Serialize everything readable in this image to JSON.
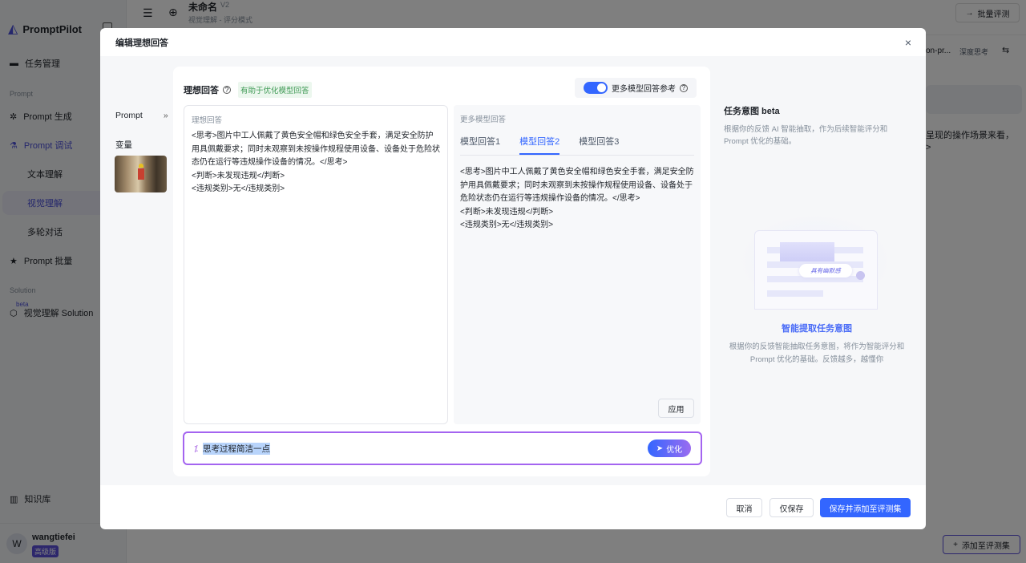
{
  "app": {
    "name": "PromptPilot",
    "doc_title": "未命名",
    "version": "V2",
    "subtitle": "视觉理解 - 评分模式",
    "batch_eval": "批量评测",
    "model_name": "on-pr...",
    "deep_think": "深度思考",
    "bg_text": "呈现的操作场景来看，",
    "bg_text2": ">",
    "add_to_set": "添加至评测集"
  },
  "sidebar": {
    "items": [
      {
        "label": "任务管理",
        "icon": "folder-icon"
      },
      {
        "label": "Prompt 生成",
        "icon": "sparkle-icon"
      },
      {
        "label": "Prompt 调试",
        "icon": "flask-icon"
      },
      {
        "label": "文本理解"
      },
      {
        "label": "视觉理解"
      },
      {
        "label": "多轮对话"
      },
      {
        "label": "Prompt 批量",
        "icon": "file-star-icon"
      },
      {
        "label": "视觉理解 Solution",
        "icon": "cube-icon",
        "badge": "beta"
      },
      {
        "label": "知识库",
        "icon": "book-icon"
      }
    ],
    "sections": [
      "Prompt",
      "Solution"
    ],
    "user": {
      "avatar": "W",
      "name": "wangtiefei",
      "plan": "高级版"
    }
  },
  "modal": {
    "title": "编辑理想回答",
    "left": {
      "prompt_label": "Prompt",
      "variables_label": "变量"
    },
    "ideal": {
      "title": "理想回答",
      "tag": "有助于优化模型回答",
      "field_label": "理想回答",
      "lines": [
        "<思考>图片中工人佩戴了黄色安全帽和绿色安全手套，满足安全防护用具佩戴要求；同时未观察到未按操作规程使用设备、设备处于危险状态仍在运行等违规操作设备的情况。</思考>",
        "<判断>未发现违规</判断>",
        "<违规类别>无</违规类别>"
      ]
    },
    "more": {
      "toggle_label": "更多模型回答参考",
      "toggle_on": true,
      "panel_label": "更多模型回答",
      "tabs": [
        "模型回答1",
        "模型回答2",
        "模型回答3"
      ],
      "active_tab": 1,
      "lines": [
        "<思考>图片中工人佩戴了黄色安全帽和绿色安全手套，满足安全防护用具佩戴要求；同时未观察到未按操作规程使用设备、设备处于危险状态仍在运行等违规操作设备的情况。</思考>",
        "<判断>未发现违规</判断>",
        "<违规类别>无</违规类别>"
      ],
      "apply": "应用"
    },
    "optimize": {
      "value": "思考过程简洁一点",
      "button": "优化"
    },
    "intent": {
      "title": "任务意图 beta",
      "desc": "根据你的反馈 AI 智能抽取，作为后续智能评分和 Prompt 优化的基础。",
      "bubble": "具有幽默感",
      "heading": "智能提取任务意图",
      "body": "根据你的反馈智能抽取任务意图，将作为智能评分和 Prompt 优化的基础。反馈越多，越懂你"
    },
    "footer": {
      "cancel": "取消",
      "save_only": "仅保存",
      "save_add": "保存并添加至评测集"
    }
  },
  "colors": {
    "primary": "#3366ff",
    "accent_purple": "#9b51e0",
    "tag_green": "#4caf50"
  }
}
